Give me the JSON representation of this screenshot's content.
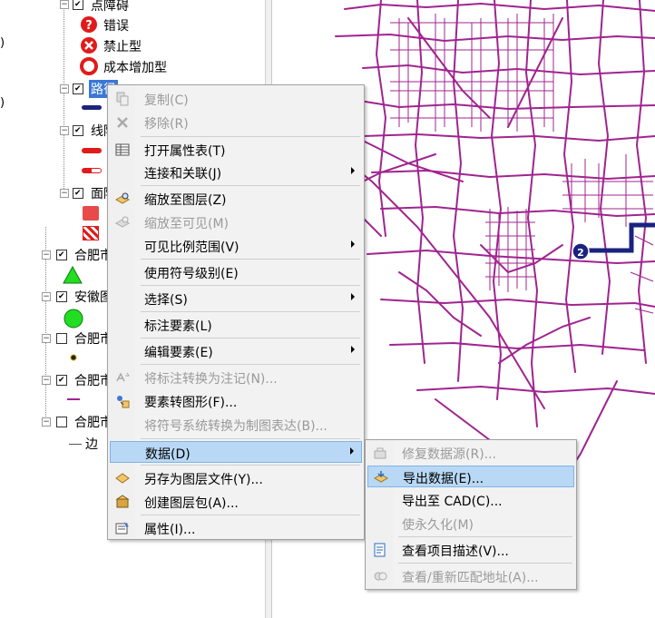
{
  "toc": {
    "layers": [
      {
        "label": "点障碍"
      },
      {
        "label": "错误"
      },
      {
        "label": "禁止型"
      },
      {
        "label": "成本增加型"
      },
      {
        "label": "路径"
      },
      {
        "label": "线障碍"
      },
      {
        "label": "面障碍"
      },
      {
        "label": "合肥市"
      },
      {
        "label": "安徽图"
      },
      {
        "label": "合肥市"
      },
      {
        "label": "合肥市"
      },
      {
        "label": "合肥市"
      },
      {
        "label": "边"
      }
    ],
    "edge_chars": [
      ")",
      ")"
    ]
  },
  "map": {
    "route_color": "#1a237e",
    "road_color": "#a0248f",
    "stop_label": "2"
  },
  "context_menu": {
    "items": [
      {
        "label": "复制(C)",
        "icon": "copy-icon",
        "enabled": false
      },
      {
        "label": "移除(R)",
        "icon": "remove-icon",
        "enabled": false
      },
      {
        "label": "打开属性表(T)",
        "icon": "table-icon",
        "enabled": true
      },
      {
        "label": "连接和关联(J)",
        "icon": "",
        "enabled": true,
        "submenu": true
      },
      {
        "label": "缩放至图层(Z)",
        "icon": "zoom-layer-icon",
        "enabled": true
      },
      {
        "label": "缩放至可见(M)",
        "icon": "zoom-visible-icon",
        "enabled": false
      },
      {
        "label": "可见比例范围(V)",
        "icon": "",
        "enabled": true,
        "submenu": true
      },
      {
        "label": "使用符号级别(E)",
        "icon": "",
        "enabled": true
      },
      {
        "label": "选择(S)",
        "icon": "",
        "enabled": true,
        "submenu": true
      },
      {
        "label": "标注要素(L)",
        "icon": "",
        "enabled": true
      },
      {
        "label": "编辑要素(E)",
        "icon": "",
        "enabled": true,
        "submenu": true
      },
      {
        "label": "将标注转换为注记(N)...",
        "icon": "convert-label-icon",
        "enabled": false
      },
      {
        "label": "要素转图形(F)...",
        "icon": "feature-graphic-icon",
        "enabled": true
      },
      {
        "label": "将符号系统转换为制图表达(B)...",
        "icon": "",
        "enabled": false
      },
      {
        "label": "数据(D)",
        "icon": "",
        "enabled": true,
        "submenu": true,
        "highlighted": true
      },
      {
        "label": "另存为图层文件(Y)...",
        "icon": "layer-file-icon",
        "enabled": true
      },
      {
        "label": "创建图层包(A)...",
        "icon": "layer-package-icon",
        "enabled": true
      },
      {
        "label": "属性(I)...",
        "icon": "properties-icon",
        "enabled": true
      }
    ]
  },
  "data_submenu": {
    "items": [
      {
        "label": "修复数据源(R)...",
        "icon": "repair-icon",
        "enabled": false
      },
      {
        "label": "导出数据(E)...",
        "icon": "export-icon",
        "enabled": true,
        "highlighted": true
      },
      {
        "label": "导出至 CAD(C)...",
        "icon": "",
        "enabled": true
      },
      {
        "label": "使永久化(M)",
        "icon": "",
        "enabled": false
      },
      {
        "label": "查看项目描述(V)...",
        "icon": "item-description-icon",
        "enabled": true
      },
      {
        "label": "查看/重新匹配地址(A)...",
        "icon": "rematch-icon",
        "enabled": false
      }
    ]
  }
}
